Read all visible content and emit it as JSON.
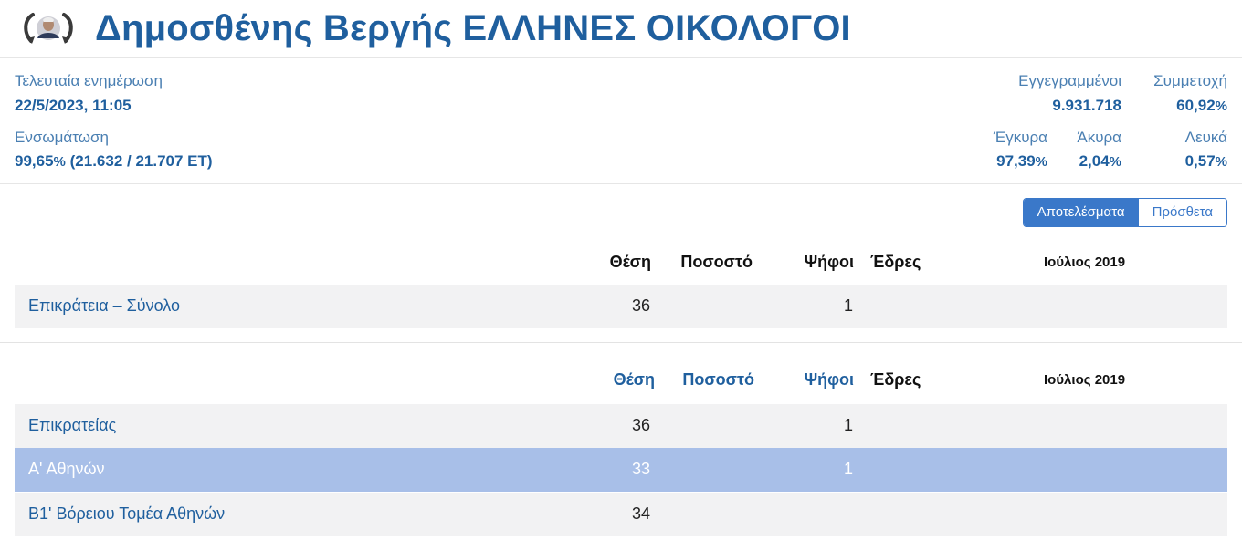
{
  "header": {
    "title": "Δημοσθένης Βεργής ΕΛΛΗΝΕΣ ΟΙΚΟΛΟΓΟΙ"
  },
  "stats": {
    "last_update_label": "Τελευταία ενημέρωση",
    "last_update_value": "22/5/2023, 11:05",
    "integration_label": "Ενσωμάτωση",
    "integration_pct": "99,65",
    "integration_detail": "(21.632 / 21.707 ΕΤ)",
    "registered_label": "Εγγεγραμμένοι",
    "registered_value": "9.931.718",
    "turnout_label": "Συμμετοχή",
    "turnout_value": "60,92",
    "valid_label": "Έγκυρα",
    "valid_value": "97,39",
    "invalid_label": "Άκυρα",
    "invalid_value": "2,04",
    "blank_label": "Λευκά",
    "blank_value": "0,57",
    "pct_sign": "%"
  },
  "toggle": {
    "results_label": "Αποτελέσματα",
    "additional_label": "Πρόσθετα"
  },
  "table1": {
    "headers": {
      "position": "Θέση",
      "percent": "Ποσοστό",
      "votes": "Ψήφοι",
      "seats": "Έδρες",
      "previous": "Ιούλιος 2019"
    },
    "rows": [
      {
        "name": "Επικράτεια – Σύνολο",
        "position": "36",
        "votes": "1"
      }
    ]
  },
  "table2": {
    "headers": {
      "position": "Θέση",
      "percent": "Ποσοστό",
      "votes": "Ψήφοι",
      "seats": "Έδρες",
      "previous": "Ιούλιος 2019"
    },
    "rows": [
      {
        "name": "Επικρατείας",
        "position": "36",
        "votes": "1"
      },
      {
        "name": "Α' Αθηνών",
        "position": "33",
        "votes": "1"
      },
      {
        "name": "Β1' Βόρειου Τομέα Αθηνών",
        "position": "34",
        "votes": ""
      }
    ]
  },
  "colors": {
    "brand": "#1f5f9e",
    "accent": "#3a78c9",
    "selected_row": "#a8bfe8",
    "row_bg": "#f2f2f3"
  },
  "icons": {
    "candidate_avatar": "candidate-portrait-icon"
  }
}
